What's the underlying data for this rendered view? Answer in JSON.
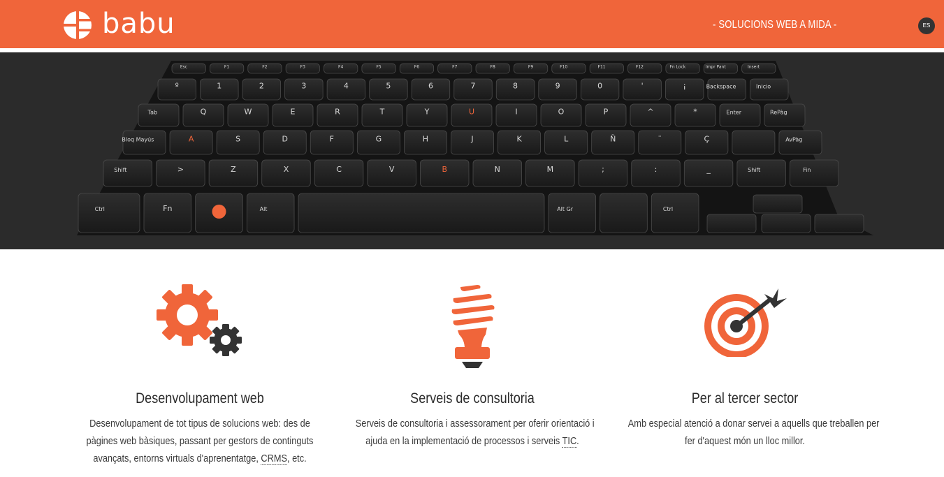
{
  "header": {
    "brand": "babu",
    "tagline": "- SOLUCIONS WEB A MIDA -",
    "language": "ES",
    "accent_color": "#f0653a",
    "dark_color": "#333333"
  },
  "hero": {
    "image": "keyboard-photo",
    "highlighted_keys": [
      "B",
      "A",
      "U"
    ]
  },
  "features": [
    {
      "icon": "gears-icon",
      "title": "Desenvolupament web",
      "lines": [
        "Desenvolupament de tot tipus de solucions web: des de",
        "pàgines web bàsiques, passant per gestors de continguts"
      ],
      "line3_pre": "avançats, entorns virtuals d'aprenentatge, ",
      "abbr": "CRMS",
      "line3_post": ", etc."
    },
    {
      "icon": "lightbulb-icon",
      "title": "Serveis de consultoria",
      "lines": [
        "Serveis de consultoria i assessorament per oferir orientació i"
      ],
      "line2_pre": "ajuda en la implementació de processos i serveis ",
      "abbr": "TIC",
      "line2_post": "."
    },
    {
      "icon": "target-icon",
      "title": "Per al tercer sector",
      "lines": [
        "Amb especial atenció a donar servei a aquells que treballen per",
        "fer d'aquest món un lloc millor."
      ]
    }
  ]
}
